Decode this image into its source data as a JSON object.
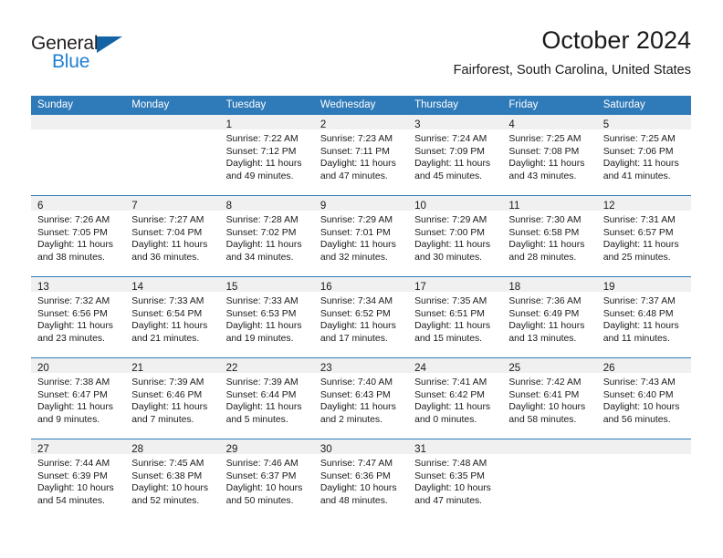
{
  "logo": {
    "primary_text": "General",
    "secondary_text": "Blue",
    "primary_color": "#231f20",
    "secondary_color": "#1f7fd4",
    "triangle_color": "#1464a5"
  },
  "header": {
    "title": "October 2024",
    "subtitle": "Fairforest, South Carolina, United States"
  },
  "theme": {
    "header_bar_color": "#2f7ab8",
    "date_band_color": "#f0f0f0",
    "row_separator_color": "#2f7ab8",
    "text_color": "#1a1a1a"
  },
  "weekdays": [
    "Sunday",
    "Monday",
    "Tuesday",
    "Wednesday",
    "Thursday",
    "Friday",
    "Saturday"
  ],
  "weeks": [
    [
      {
        "day": "",
        "sunrise": "",
        "sunset": "",
        "daylight_line1": "",
        "daylight_line2": ""
      },
      {
        "day": "",
        "sunrise": "",
        "sunset": "",
        "daylight_line1": "",
        "daylight_line2": ""
      },
      {
        "day": "1",
        "sunrise": "Sunrise: 7:22 AM",
        "sunset": "Sunset: 7:12 PM",
        "daylight_line1": "Daylight: 11 hours",
        "daylight_line2": "and 49 minutes."
      },
      {
        "day": "2",
        "sunrise": "Sunrise: 7:23 AM",
        "sunset": "Sunset: 7:11 PM",
        "daylight_line1": "Daylight: 11 hours",
        "daylight_line2": "and 47 minutes."
      },
      {
        "day": "3",
        "sunrise": "Sunrise: 7:24 AM",
        "sunset": "Sunset: 7:09 PM",
        "daylight_line1": "Daylight: 11 hours",
        "daylight_line2": "and 45 minutes."
      },
      {
        "day": "4",
        "sunrise": "Sunrise: 7:25 AM",
        "sunset": "Sunset: 7:08 PM",
        "daylight_line1": "Daylight: 11 hours",
        "daylight_line2": "and 43 minutes."
      },
      {
        "day": "5",
        "sunrise": "Sunrise: 7:25 AM",
        "sunset": "Sunset: 7:06 PM",
        "daylight_line1": "Daylight: 11 hours",
        "daylight_line2": "and 41 minutes."
      }
    ],
    [
      {
        "day": "6",
        "sunrise": "Sunrise: 7:26 AM",
        "sunset": "Sunset: 7:05 PM",
        "daylight_line1": "Daylight: 11 hours",
        "daylight_line2": "and 38 minutes."
      },
      {
        "day": "7",
        "sunrise": "Sunrise: 7:27 AM",
        "sunset": "Sunset: 7:04 PM",
        "daylight_line1": "Daylight: 11 hours",
        "daylight_line2": "and 36 minutes."
      },
      {
        "day": "8",
        "sunrise": "Sunrise: 7:28 AM",
        "sunset": "Sunset: 7:02 PM",
        "daylight_line1": "Daylight: 11 hours",
        "daylight_line2": "and 34 minutes."
      },
      {
        "day": "9",
        "sunrise": "Sunrise: 7:29 AM",
        "sunset": "Sunset: 7:01 PM",
        "daylight_line1": "Daylight: 11 hours",
        "daylight_line2": "and 32 minutes."
      },
      {
        "day": "10",
        "sunrise": "Sunrise: 7:29 AM",
        "sunset": "Sunset: 7:00 PM",
        "daylight_line1": "Daylight: 11 hours",
        "daylight_line2": "and 30 minutes."
      },
      {
        "day": "11",
        "sunrise": "Sunrise: 7:30 AM",
        "sunset": "Sunset: 6:58 PM",
        "daylight_line1": "Daylight: 11 hours",
        "daylight_line2": "and 28 minutes."
      },
      {
        "day": "12",
        "sunrise": "Sunrise: 7:31 AM",
        "sunset": "Sunset: 6:57 PM",
        "daylight_line1": "Daylight: 11 hours",
        "daylight_line2": "and 25 minutes."
      }
    ],
    [
      {
        "day": "13",
        "sunrise": "Sunrise: 7:32 AM",
        "sunset": "Sunset: 6:56 PM",
        "daylight_line1": "Daylight: 11 hours",
        "daylight_line2": "and 23 minutes."
      },
      {
        "day": "14",
        "sunrise": "Sunrise: 7:33 AM",
        "sunset": "Sunset: 6:54 PM",
        "daylight_line1": "Daylight: 11 hours",
        "daylight_line2": "and 21 minutes."
      },
      {
        "day": "15",
        "sunrise": "Sunrise: 7:33 AM",
        "sunset": "Sunset: 6:53 PM",
        "daylight_line1": "Daylight: 11 hours",
        "daylight_line2": "and 19 minutes."
      },
      {
        "day": "16",
        "sunrise": "Sunrise: 7:34 AM",
        "sunset": "Sunset: 6:52 PM",
        "daylight_line1": "Daylight: 11 hours",
        "daylight_line2": "and 17 minutes."
      },
      {
        "day": "17",
        "sunrise": "Sunrise: 7:35 AM",
        "sunset": "Sunset: 6:51 PM",
        "daylight_line1": "Daylight: 11 hours",
        "daylight_line2": "and 15 minutes."
      },
      {
        "day": "18",
        "sunrise": "Sunrise: 7:36 AM",
        "sunset": "Sunset: 6:49 PM",
        "daylight_line1": "Daylight: 11 hours",
        "daylight_line2": "and 13 minutes."
      },
      {
        "day": "19",
        "sunrise": "Sunrise: 7:37 AM",
        "sunset": "Sunset: 6:48 PM",
        "daylight_line1": "Daylight: 11 hours",
        "daylight_line2": "and 11 minutes."
      }
    ],
    [
      {
        "day": "20",
        "sunrise": "Sunrise: 7:38 AM",
        "sunset": "Sunset: 6:47 PM",
        "daylight_line1": "Daylight: 11 hours",
        "daylight_line2": "and 9 minutes."
      },
      {
        "day": "21",
        "sunrise": "Sunrise: 7:39 AM",
        "sunset": "Sunset: 6:46 PM",
        "daylight_line1": "Daylight: 11 hours",
        "daylight_line2": "and 7 minutes."
      },
      {
        "day": "22",
        "sunrise": "Sunrise: 7:39 AM",
        "sunset": "Sunset: 6:44 PM",
        "daylight_line1": "Daylight: 11 hours",
        "daylight_line2": "and 5 minutes."
      },
      {
        "day": "23",
        "sunrise": "Sunrise: 7:40 AM",
        "sunset": "Sunset: 6:43 PM",
        "daylight_line1": "Daylight: 11 hours",
        "daylight_line2": "and 2 minutes."
      },
      {
        "day": "24",
        "sunrise": "Sunrise: 7:41 AM",
        "sunset": "Sunset: 6:42 PM",
        "daylight_line1": "Daylight: 11 hours",
        "daylight_line2": "and 0 minutes."
      },
      {
        "day": "25",
        "sunrise": "Sunrise: 7:42 AM",
        "sunset": "Sunset: 6:41 PM",
        "daylight_line1": "Daylight: 10 hours",
        "daylight_line2": "and 58 minutes."
      },
      {
        "day": "26",
        "sunrise": "Sunrise: 7:43 AM",
        "sunset": "Sunset: 6:40 PM",
        "daylight_line1": "Daylight: 10 hours",
        "daylight_line2": "and 56 minutes."
      }
    ],
    [
      {
        "day": "27",
        "sunrise": "Sunrise: 7:44 AM",
        "sunset": "Sunset: 6:39 PM",
        "daylight_line1": "Daylight: 10 hours",
        "daylight_line2": "and 54 minutes."
      },
      {
        "day": "28",
        "sunrise": "Sunrise: 7:45 AM",
        "sunset": "Sunset: 6:38 PM",
        "daylight_line1": "Daylight: 10 hours",
        "daylight_line2": "and 52 minutes."
      },
      {
        "day": "29",
        "sunrise": "Sunrise: 7:46 AM",
        "sunset": "Sunset: 6:37 PM",
        "daylight_line1": "Daylight: 10 hours",
        "daylight_line2": "and 50 minutes."
      },
      {
        "day": "30",
        "sunrise": "Sunrise: 7:47 AM",
        "sunset": "Sunset: 6:36 PM",
        "daylight_line1": "Daylight: 10 hours",
        "daylight_line2": "and 48 minutes."
      },
      {
        "day": "31",
        "sunrise": "Sunrise: 7:48 AM",
        "sunset": "Sunset: 6:35 PM",
        "daylight_line1": "Daylight: 10 hours",
        "daylight_line2": "and 47 minutes."
      },
      {
        "day": "",
        "sunrise": "",
        "sunset": "",
        "daylight_line1": "",
        "daylight_line2": ""
      },
      {
        "day": "",
        "sunrise": "",
        "sunset": "",
        "daylight_line1": "",
        "daylight_line2": ""
      }
    ]
  ]
}
